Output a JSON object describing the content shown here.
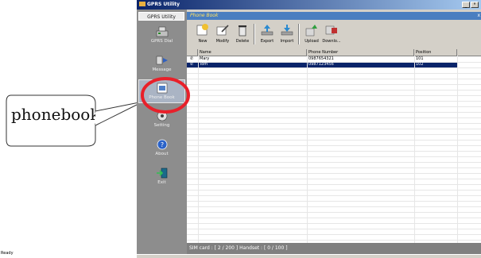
{
  "window": {
    "title": "GPRS Utility",
    "min_label": "_",
    "restore_label": "°"
  },
  "sidebar": {
    "tab_label": "GPRS Utility",
    "items": [
      {
        "label": "GPRS Dial",
        "icon": "modem-icon"
      },
      {
        "label": "Message",
        "icon": "message-icon"
      },
      {
        "label": "Phone Book",
        "icon": "phonebook-icon"
      },
      {
        "label": "Setting",
        "icon": "settings-icon"
      },
      {
        "label": "About",
        "icon": "help-icon"
      },
      {
        "label": "Exit",
        "icon": "exit-icon"
      }
    ]
  },
  "panel": {
    "title": "Phone Book",
    "close_label": "x"
  },
  "toolbar": {
    "buttons": [
      "New",
      "Modify",
      "Delete",
      "Export",
      "Import",
      "Upload",
      "Downlo..."
    ]
  },
  "table": {
    "headers": [
      "Name",
      "Phone Number",
      "Position"
    ],
    "rows": [
      {
        "name": "Mary",
        "phone": "0987654321",
        "position": "101"
      },
      {
        "name": "Tom",
        "phone": "0987123456",
        "position": "102"
      }
    ]
  },
  "status": {
    "text": "SIM card : [ 2 / 200 ]   Handset : [ 0 / 100 ]",
    "ready": "Ready"
  },
  "callout": {
    "label": "phonebook"
  },
  "colors": {
    "highlight_ring": "#e8202a",
    "selection": "#0a246a",
    "sidebar_bg": "#8d8d8d"
  }
}
